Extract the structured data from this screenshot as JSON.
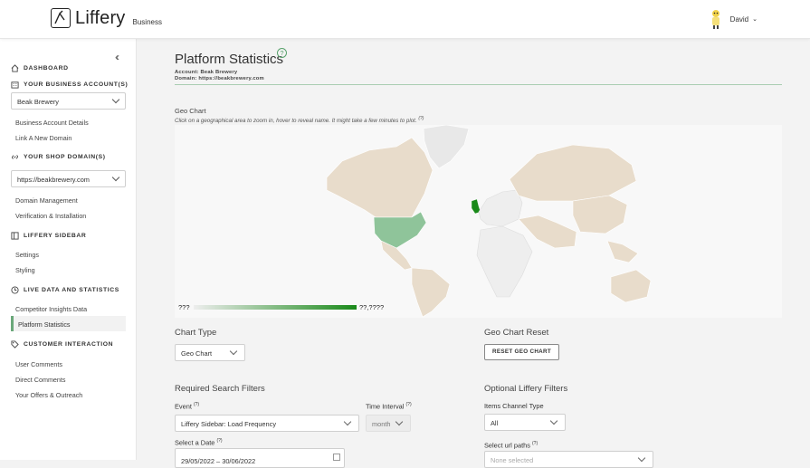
{
  "header": {
    "logo_name": "Liffery",
    "logo_sub": "Business",
    "user_name": "David"
  },
  "sidebar": {
    "sections": {
      "dashboard": "DASHBOARD",
      "business_account": "YOUR BUSINESS ACCOUNT(S)",
      "shop_domain": "YOUR SHOP DOMAIN(S)",
      "liffery_sidebar": "LIFFERY SIDEBAR",
      "live_data": "LIVE DATA AND STATISTICS",
      "customer_interaction": "CUSTOMER INTERACTION"
    },
    "account_select": "Beak Brewery",
    "domain_select": "https://beakbrewery.com",
    "items": {
      "business_account_details": "Business Account Details",
      "link_new_domain": "Link A New Domain",
      "domain_management": "Domain Management",
      "verification": "Verification & Installation",
      "settings": "Settings",
      "styling": "Styling",
      "competitor_insights": "Competitor Insights Data",
      "platform_statistics": "Platform Statistics",
      "user_comments": "User Comments",
      "direct_comments": "Direct Comments",
      "offers_outreach": "Your Offers & Outreach"
    }
  },
  "main": {
    "title": "Platform Statistics",
    "help_glyph": "?",
    "account_line": "Account: Beak Brewery",
    "domain_line": "Domain: https://beakbrewery.com",
    "geo_title": "Geo Chart",
    "geo_subtitle": "Click on a geographical area to zoom in, hover to reveal name. It might take a few minutes to plot.",
    "help_sup": "(?)",
    "legend_min": "???",
    "legend_max": "??,????",
    "chart_type_label": "Chart Type",
    "chart_type_value": "Geo Chart",
    "reset_label": "Geo Chart Reset",
    "reset_button": "RESET GEO CHART",
    "required_filters": "Required Search Filters",
    "event_label": "Event",
    "event_value": "Liffery Sidebar: Load Frequency",
    "interval_label": "Time Interval",
    "interval_value": "month",
    "date_label": "Select a Date",
    "date_value": "29/05/2022 – 30/06/2022",
    "optional_filters": "Optional Liffery Filters",
    "channel_label": "Items Channel Type",
    "channel_value": "All",
    "url_paths_label": "Select url paths",
    "url_paths_placeholder": "None selected"
  },
  "colors": {
    "accent": "#5aa36d",
    "map_land": "#e8dccb",
    "map_usa": "#8fc49a",
    "map_uk": "#1a8a1a"
  }
}
